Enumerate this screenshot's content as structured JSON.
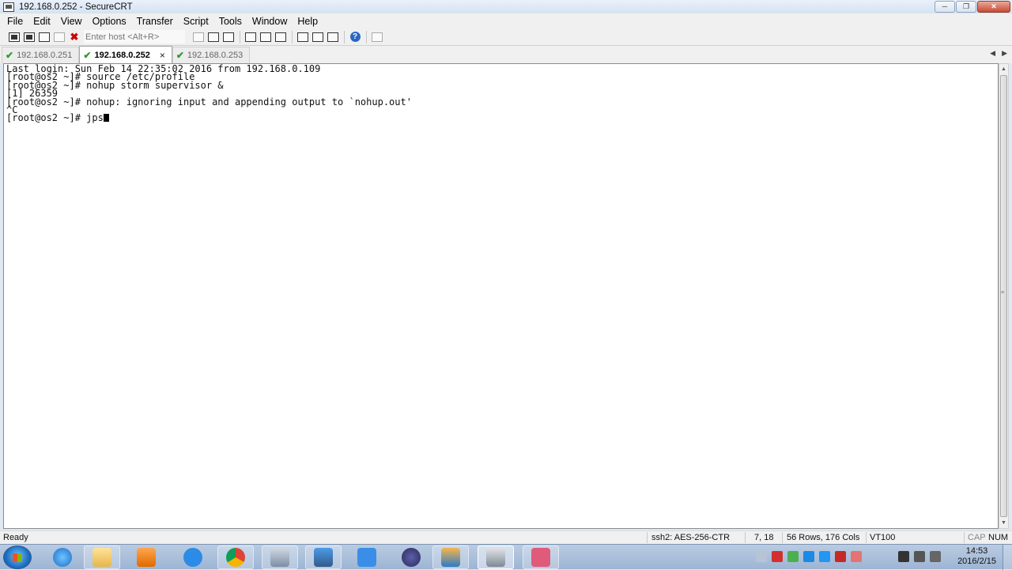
{
  "window": {
    "title": "192.168.0.252 - SecureCRT",
    "minimize": "─",
    "maximize": "❐",
    "close": "✕"
  },
  "menu": [
    "File",
    "Edit",
    "View",
    "Options",
    "Transfer",
    "Script",
    "Tools",
    "Window",
    "Help"
  ],
  "toolbar": {
    "host_placeholder": "Enter host <Alt+R>"
  },
  "tabs": [
    {
      "label": "192.168.0.251",
      "active": false
    },
    {
      "label": "192.168.0.252",
      "active": true,
      "close": "×"
    },
    {
      "label": "192.168.0.253",
      "active": false
    }
  ],
  "tab_scroll": {
    "left": "◀",
    "right": "▶"
  },
  "terminal": {
    "lines": [
      "Last login: Sun Feb 14 22:35:02 2016 from 192.168.0.109",
      "[root@os2 ~]# source /etc/profile",
      "[root@os2 ~]# nohup storm supervisor &",
      "[1] 26359",
      "[root@os2 ~]# nohup: ignoring input and appending output to `nohup.out'",
      "^C"
    ],
    "prompt_line": "[root@os2 ~]# jps"
  },
  "status": {
    "ready": "Ready",
    "encryption": "ssh2: AES-256-CTR",
    "cursor_pos": "7,  18",
    "size": "56 Rows, 176 Cols",
    "emulation": "VT100",
    "caps": "CAP",
    "num": "NUM"
  },
  "taskbar": {
    "clock_time": "14:53",
    "clock_date": "2016/2/15"
  },
  "colors": {
    "tab_check": "#2e9b2e",
    "taskbar": "#a6bcd9"
  }
}
